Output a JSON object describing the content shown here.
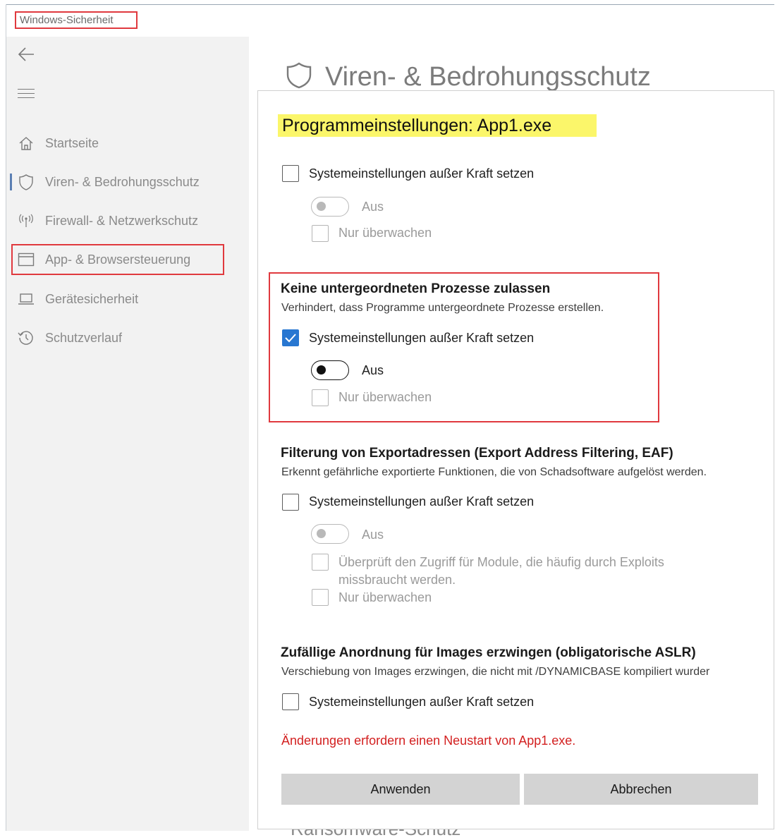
{
  "window": {
    "title": "Windows-Sicherheit"
  },
  "sidebar": {
    "back_icon": "back-arrow-icon",
    "menu_icon": "hamburger-menu-icon",
    "items": [
      {
        "label": "Startseite",
        "icon": "home-icon"
      },
      {
        "label": "Viren- & Bedrohungsschutz",
        "icon": "shield-icon",
        "selected": true
      },
      {
        "label": "Firewall- & Netzwerkschutz",
        "icon": "antenna-icon"
      },
      {
        "label": "App- & Browsersteuerung",
        "icon": "app-window-icon",
        "highlighted": true
      },
      {
        "label": "Gerätesicherheit",
        "icon": "laptop-icon"
      },
      {
        "label": "Schutzverlauf",
        "icon": "history-icon"
      }
    ]
  },
  "header": {
    "title": "Viren- & Bedrohungsschutz",
    "icon": "shield-icon"
  },
  "panel": {
    "title": "Programmeinstellungen: App1.exe",
    "section0": {
      "override_label": "Systemeinstellungen außer Kraft setzen",
      "override_checked": false,
      "toggle_label": "Aus",
      "toggle_on": false,
      "audit_label": "Nur überwachen"
    },
    "section1": {
      "title": "Keine untergeordneten Prozesse zulassen",
      "desc": "Verhindert, dass Programme untergeordnete Prozesse erstellen.",
      "override_label": "Systemeinstellungen außer Kraft setzen",
      "override_checked": true,
      "toggle_label": "Aus",
      "toggle_on": true,
      "audit_label": "Nur überwachen"
    },
    "section2": {
      "title": "Filterung von Exportadressen (Export Address Filtering, EAF)",
      "desc": "Erkennt gefährliche exportierte Funktionen, die von Schadsoftware aufgelöst werden.",
      "override_label": "Systemeinstellungen außer Kraft setzen",
      "override_checked": false,
      "toggle_label": "Aus",
      "toggle_on": false,
      "module_check_line1": "Überprüft den Zugriff für Module, die häufig durch Exploits",
      "module_check_line2": "missbraucht werden.",
      "audit_label": "Nur überwachen"
    },
    "section3": {
      "title": "Zufällige Anordnung für Images erzwingen (obligatorische ASLR)",
      "desc": "Verschiebung von Images erzwingen, die nicht mit /DYNAMICBASE kompiliert wurder",
      "override_label": "Systemeinstellungen außer Kraft setzen",
      "override_checked": false
    },
    "restart_warning": "Änderungen erfordern einen Neustart von App1.exe.",
    "apply_label": "Anwenden",
    "cancel_label": "Abbrechen",
    "behind_text": "Ransomware-Schutz"
  }
}
